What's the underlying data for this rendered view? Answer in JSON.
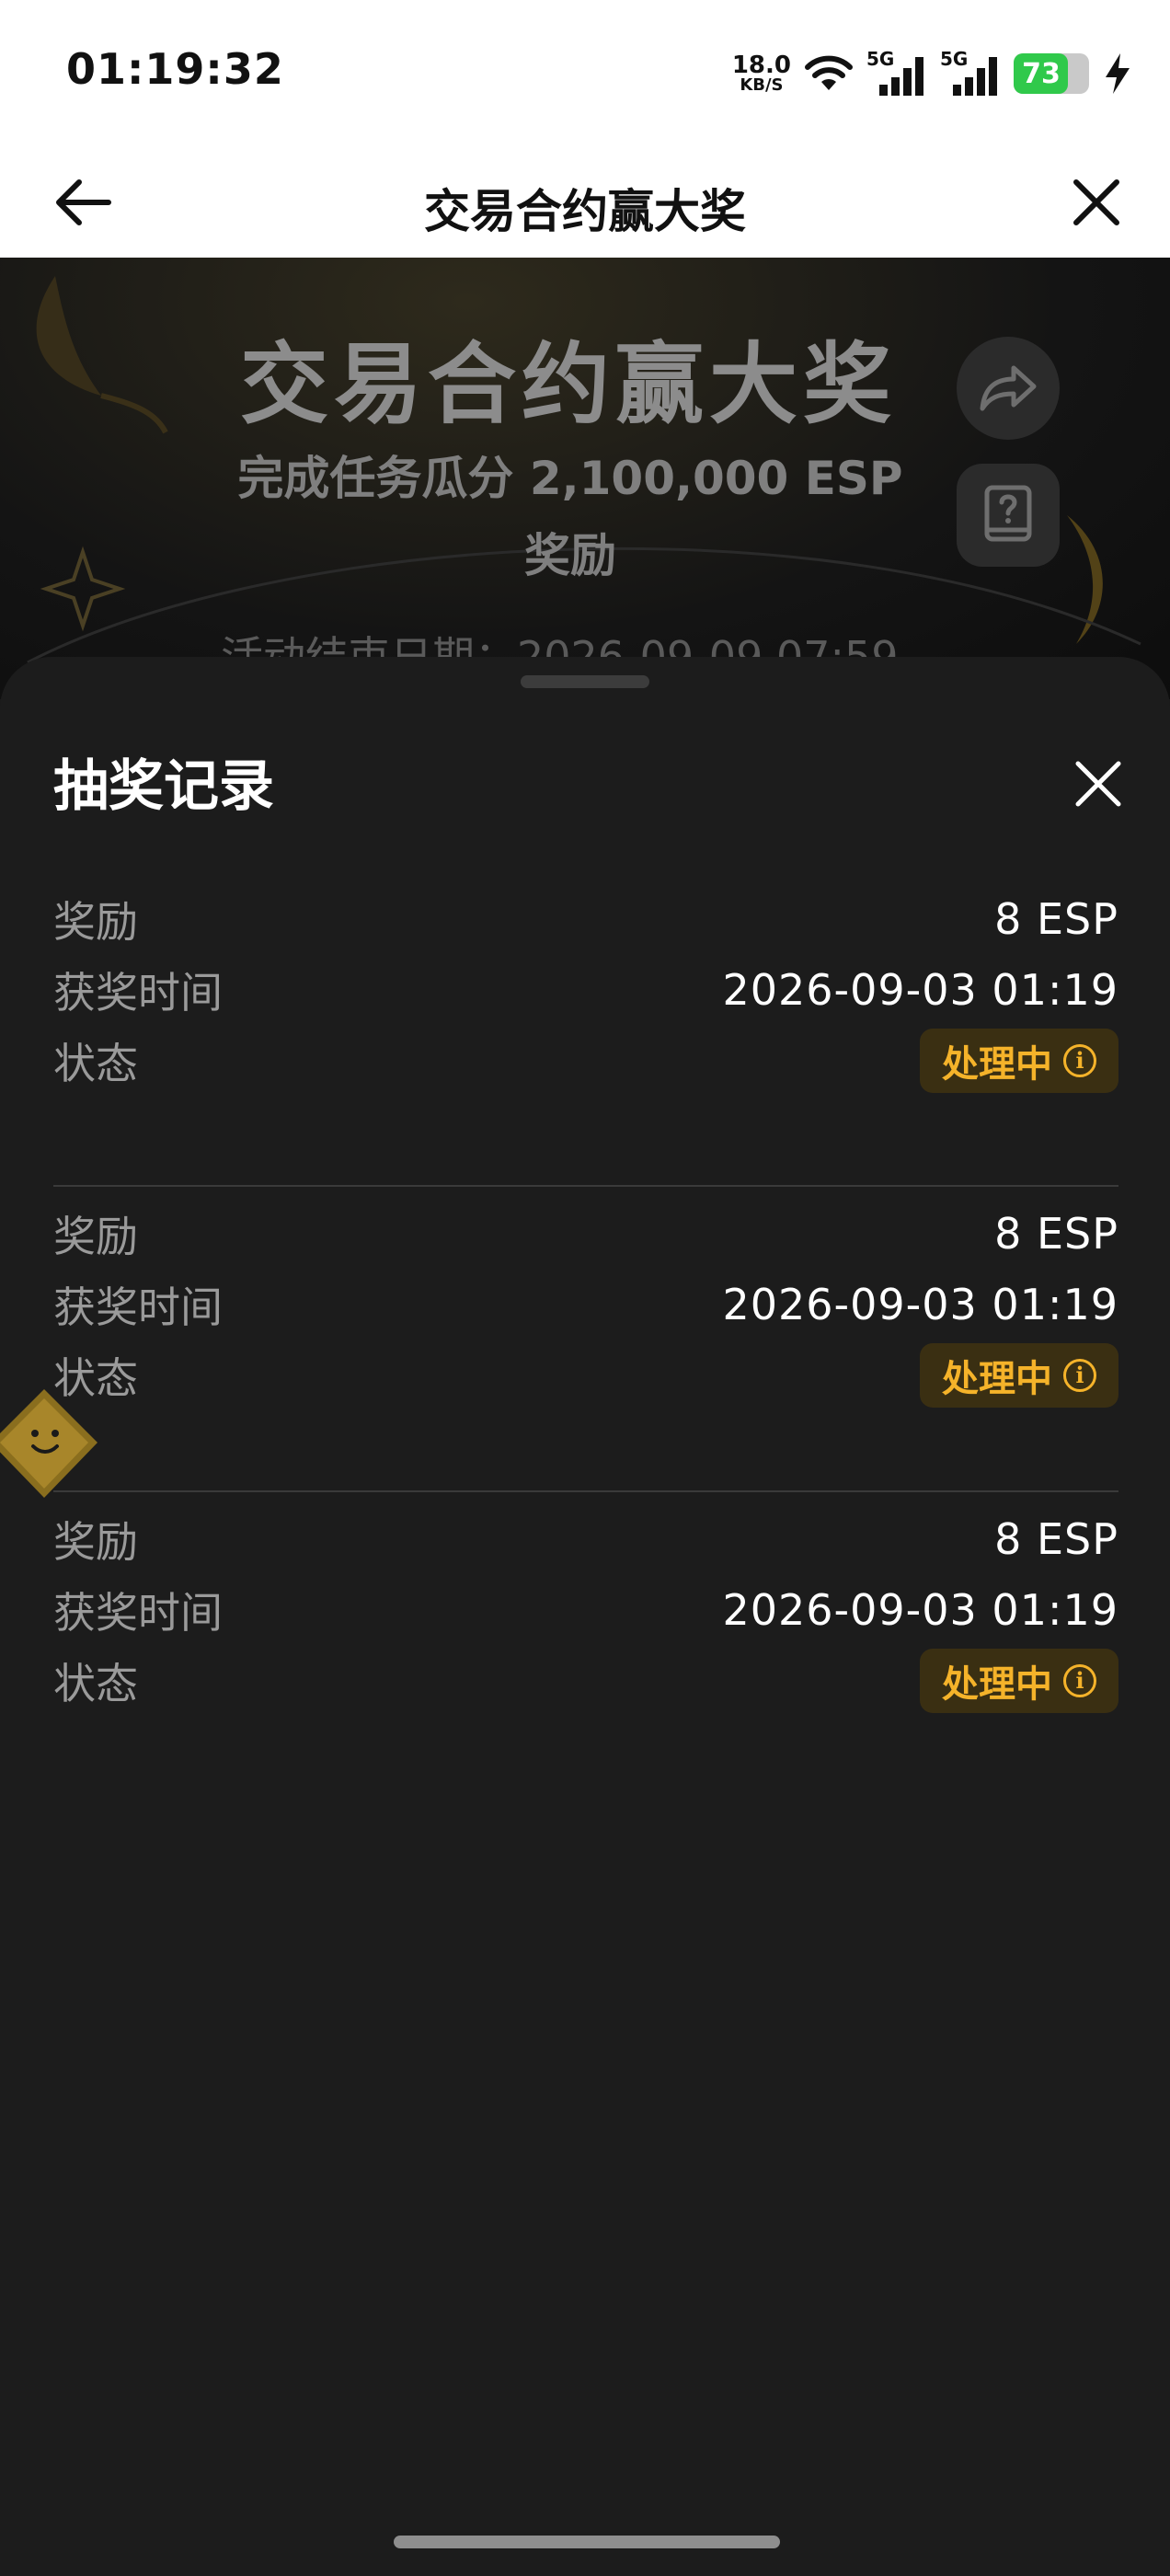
{
  "status_bar": {
    "time": "01:19:32",
    "net_speed_value": "18.0",
    "net_speed_unit": "KB/S",
    "signal1_label": "5G",
    "signal2_label": "5G",
    "battery": "73"
  },
  "header": {
    "title": "交易合约赢大奖"
  },
  "banner": {
    "title": "交易合约赢大奖",
    "subtitle": "完成任务瓜分 2,100,000 ESP 奖励",
    "end_date": "活动结束日期：2026-09-09 07:59"
  },
  "sheet": {
    "title": "抽奖记录",
    "records": [
      {
        "reward_label": "奖励",
        "reward_value": "8 ESP",
        "time_label": "获奖时间",
        "time_value": "2026-09-03 01:19",
        "status_label": "状态",
        "status_value": "处理中"
      },
      {
        "reward_label": "奖励",
        "reward_value": "8 ESP",
        "time_label": "获奖时间",
        "time_value": "2026-09-03 01:19",
        "status_label": "状态",
        "status_value": "处理中"
      },
      {
        "reward_label": "奖励",
        "reward_value": "8 ESP",
        "time_label": "获奖时间",
        "time_value": "2026-09-03 01:19",
        "status_label": "状态",
        "status_value": "处理中"
      }
    ]
  },
  "colors": {
    "sheet_bg": "#1c1c1c",
    "status_accent": "#f5b32a",
    "status_chip_bg": "#3a2f12",
    "battery_green": "#30c94b"
  }
}
